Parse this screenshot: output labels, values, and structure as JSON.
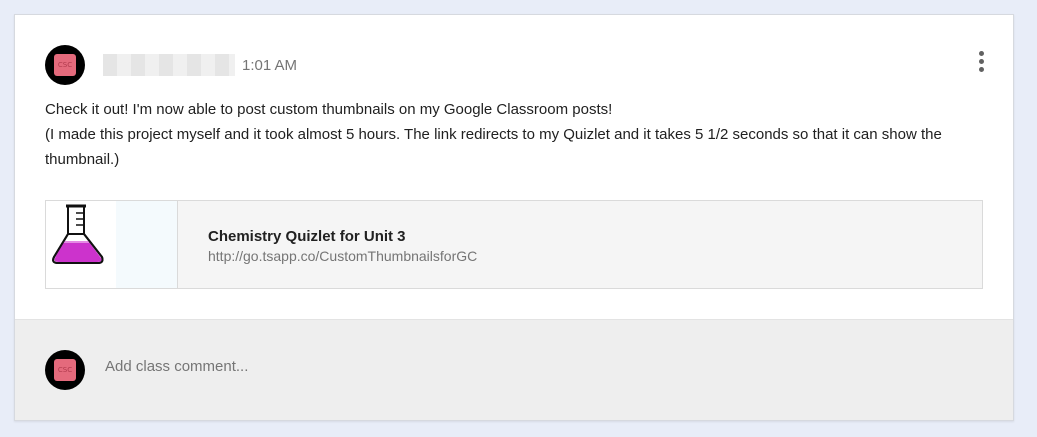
{
  "post": {
    "avatar_initials": "CSC",
    "timestamp": "1:01 AM",
    "more_icon": "more-vert-icon",
    "body_line1": "Check it out! I'm now able to post custom thumbnails on my Google Classroom posts!",
    "body_line2": "(I made this project myself and it took almost 5 hours. The link redirects to my Quizlet and it takes 5 1/2 seconds so that it can show the thumbnail.)"
  },
  "attachment": {
    "thumbnail_icon": "flask-icon",
    "title": "Chemistry Quizlet for Unit 3",
    "url": "http://go.tsapp.co/CustomThumbnailsforGC"
  },
  "comment": {
    "avatar_initials": "CSC",
    "placeholder": "Add class comment..."
  },
  "colors": {
    "page_bg": "#e8edf8",
    "card_bg": "#ffffff",
    "comment_bg": "#eeeeee",
    "flask_liquid": "#cc33cc"
  }
}
